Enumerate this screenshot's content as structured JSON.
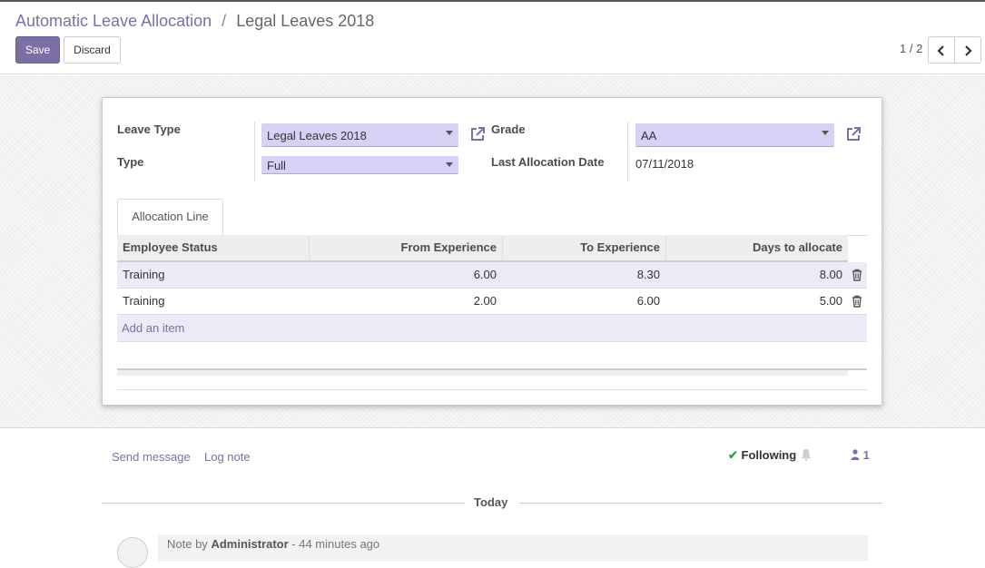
{
  "breadcrumb": {
    "parent": "Automatic Leave Allocation",
    "separator": "/",
    "current": "Legal Leaves 2018"
  },
  "buttons": {
    "save": "Save",
    "discard": "Discard"
  },
  "pager": {
    "value": "1 / 2",
    "prev_icon": "chevron-left-icon",
    "next_icon": "chevron-right-icon"
  },
  "form": {
    "leave_type_label": "Leave Type",
    "leave_type_value": "Legal Leaves 2018",
    "type_label": "Type",
    "type_value": "Full",
    "grade_label": "Grade",
    "grade_value": "AA",
    "last_allocation_label": "Last Allocation Date",
    "last_allocation_value": "07/11/2018"
  },
  "tab": {
    "label": "Allocation Line"
  },
  "table": {
    "columns": [
      "Employee Status",
      "From Experience",
      "To Experience",
      "Days to allocate"
    ],
    "rows": [
      {
        "status": "Training",
        "from": "6.00",
        "to": "8.30",
        "days": "8.00"
      },
      {
        "status": "Training",
        "from": "2.00",
        "to": "6.00",
        "days": "5.00"
      }
    ],
    "add_item": "Add an item"
  },
  "chatter": {
    "send_message": "Send message",
    "log_note": "Log note",
    "following": "Following",
    "followers_count": "1",
    "today": "Today",
    "note_prefix": "Note by",
    "note_author": "Administrator",
    "note_time": "- 44 minutes ago"
  },
  "colors": {
    "accent": "#7c6fa6",
    "field_bg": "#d9d0f6",
    "success": "#28a745"
  }
}
